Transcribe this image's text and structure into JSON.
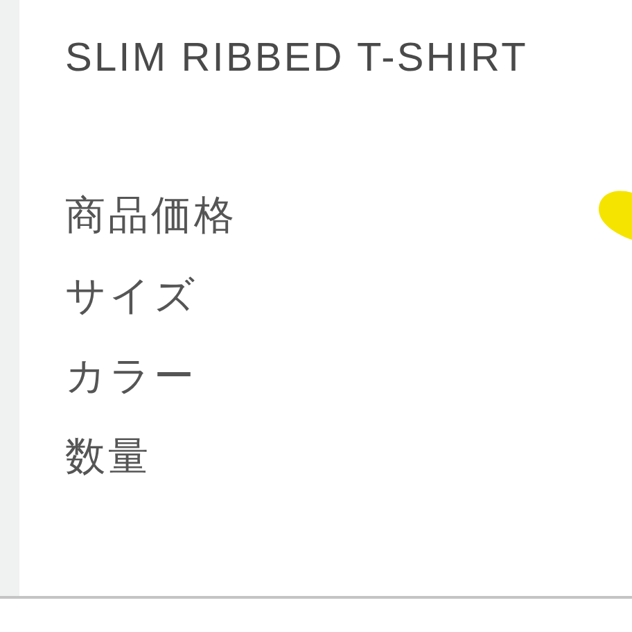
{
  "product": {
    "title": "SLIM RIBBED T-SHIRT"
  },
  "specs": [
    {
      "label": "商品価格"
    },
    {
      "label": "サイズ"
    },
    {
      "label": "カラー"
    },
    {
      "label": "数量"
    }
  ]
}
